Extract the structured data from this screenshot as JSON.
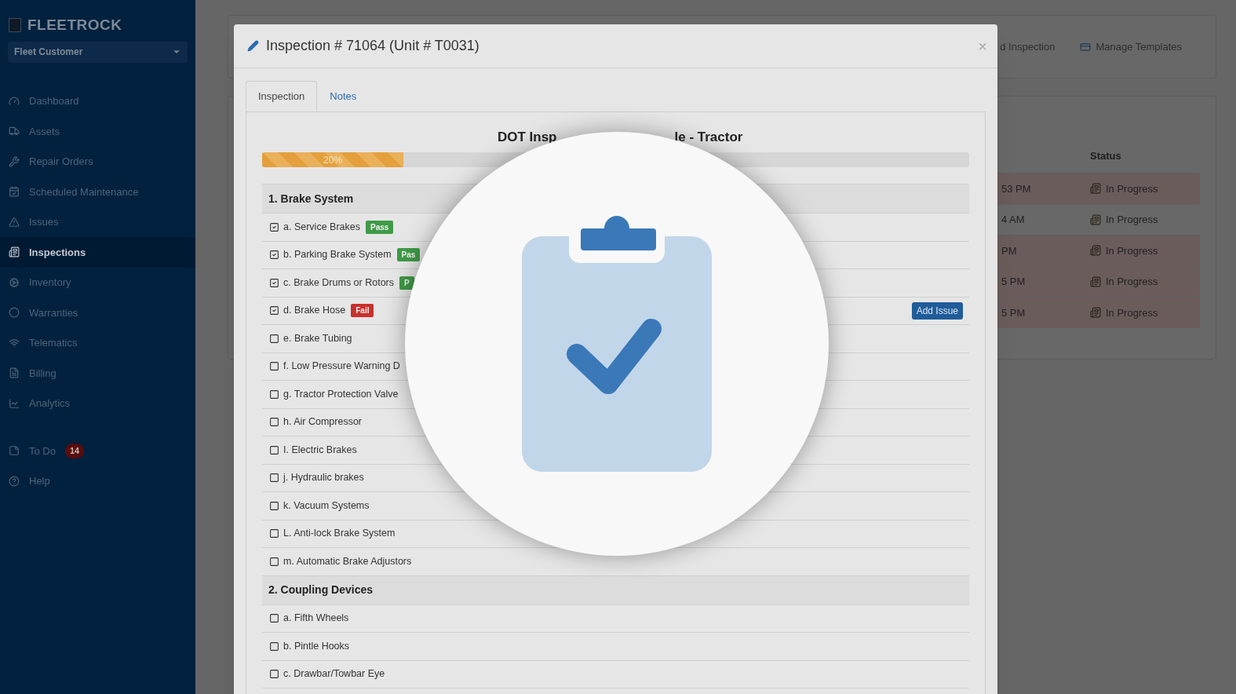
{
  "sidebar": {
    "brand": "FLEETROCK",
    "account_select": "Fleet Customer",
    "items": [
      {
        "label": "Dashboard",
        "selected": false
      },
      {
        "label": "Assets",
        "selected": false
      },
      {
        "label": "Repair Orders",
        "selected": false
      },
      {
        "label": "Scheduled Maintenance",
        "selected": false
      },
      {
        "label": "Issues",
        "selected": false
      },
      {
        "label": "Inspections",
        "selected": true
      },
      {
        "label": "Inventory",
        "selected": false
      },
      {
        "label": "Warranties",
        "selected": false
      },
      {
        "label": "Telematics",
        "selected": false
      },
      {
        "label": "Billing",
        "selected": false
      },
      {
        "label": "Analytics",
        "selected": false
      }
    ],
    "bottom_items": [
      {
        "label": "To Do",
        "badge": "14"
      },
      {
        "label": "Help"
      }
    ]
  },
  "background": {
    "toolbar_links": [
      "d Inspection",
      "Manage Templates"
    ],
    "table": {
      "columns": [
        "Status"
      ],
      "rows": [
        {
          "column_1": "53 PM",
          "status": "In Progress",
          "highlighted": true
        },
        {
          "column_1": "4 AM",
          "status": "In Progress",
          "highlighted": false
        },
        {
          "column_1": "PM",
          "status": "In Progress",
          "highlighted": true
        },
        {
          "column_1": "5 PM",
          "status": "In Progress",
          "highlighted": true
        },
        {
          "column_1": "5 PM",
          "status": "In Progress",
          "highlighted": true
        }
      ]
    }
  },
  "modal": {
    "title": "Inspection # 71064 (Unit # T0031)",
    "close": "×",
    "tabs": [
      {
        "label": "Inspection",
        "selected": true
      },
      {
        "label": "Notes",
        "selected": false
      }
    ],
    "heading_left": "DOT Insp",
    "heading_right": "le - Tractor",
    "progress": {
      "level": 0.2,
      "label": "20%"
    },
    "sections": [
      {
        "title": "1. Brake System",
        "items": [
          {
            "label": "a. Service Brakes",
            "checked": true,
            "result": {
              "text": "Pass",
              "kind": "pass"
            }
          },
          {
            "label": "b. Parking Brake System",
            "checked": true,
            "result": {
              "text": "Pas",
              "kind": "pass"
            }
          },
          {
            "label": "c. Brake Drums or Rotors",
            "checked": true,
            "result": {
              "text": "P",
              "kind": "pass"
            }
          },
          {
            "label": "d. Brake Hose",
            "checked": true,
            "result": {
              "text": "Fail",
              "kind": "fail"
            },
            "action": "Add Issue"
          },
          {
            "label": "e. Brake Tubing",
            "checked": false
          },
          {
            "label": "f. Low Pressure Warning D",
            "checked": false
          },
          {
            "label": "g. Tractor Protection Valve",
            "checked": false
          },
          {
            "label": "h. Air Compressor",
            "checked": false
          },
          {
            "label": "I. Electric Brakes",
            "checked": false
          },
          {
            "label": "j. Hydraulic brakes",
            "checked": false
          },
          {
            "label": "k. Vacuum Systems",
            "checked": false
          },
          {
            "label": "L. Anti-lock Brake System",
            "checked": false
          },
          {
            "label": "m. Automatic Brake Adjustors",
            "checked": false
          }
        ]
      },
      {
        "title": "2. Coupling Devices",
        "items": [
          {
            "label": "a. Fifth Wheels",
            "checked": false
          },
          {
            "label": "b. Pintle Hooks",
            "checked": false
          },
          {
            "label": "c. Drawbar/Towbar Eye",
            "checked": false
          }
        ]
      }
    ]
  }
}
